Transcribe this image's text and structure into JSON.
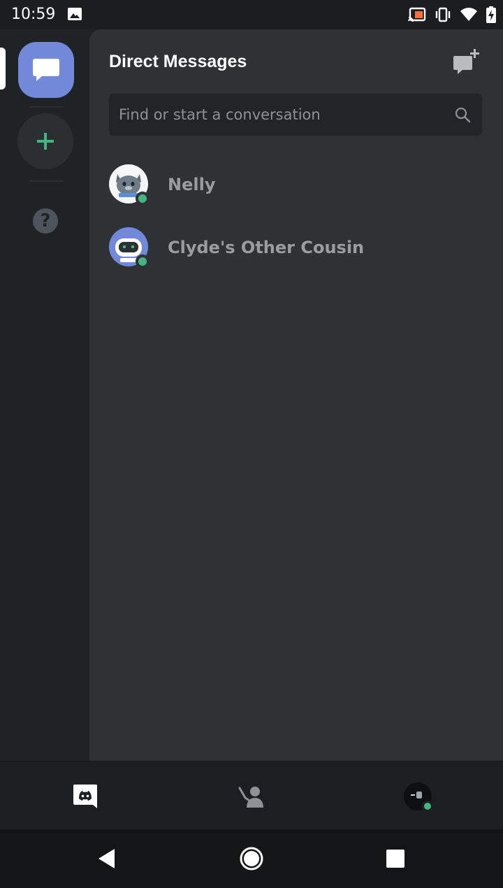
{
  "status_bar": {
    "time": "10:59"
  },
  "guild_rail": {
    "home_icon": "chat-bubble-icon",
    "add_icon": "plus-icon",
    "help_label": "?"
  },
  "dm_panel": {
    "title": "Direct Messages",
    "search": {
      "placeholder": "Find or start a conversation"
    },
    "conversations": [
      {
        "name": "Nelly",
        "status": "online",
        "avatar": "nelly-cat-avatar"
      },
      {
        "name": "Clyde's Other Cousin",
        "status": "online",
        "avatar": "robot-avatar"
      }
    ]
  },
  "tab_bar": {
    "tabs": [
      "home",
      "friends",
      "profile"
    ]
  },
  "colors": {
    "blurple": "#7289da",
    "online_green": "#43b581",
    "panel_bg": "#2f3234",
    "rail_bg": "#202325"
  }
}
